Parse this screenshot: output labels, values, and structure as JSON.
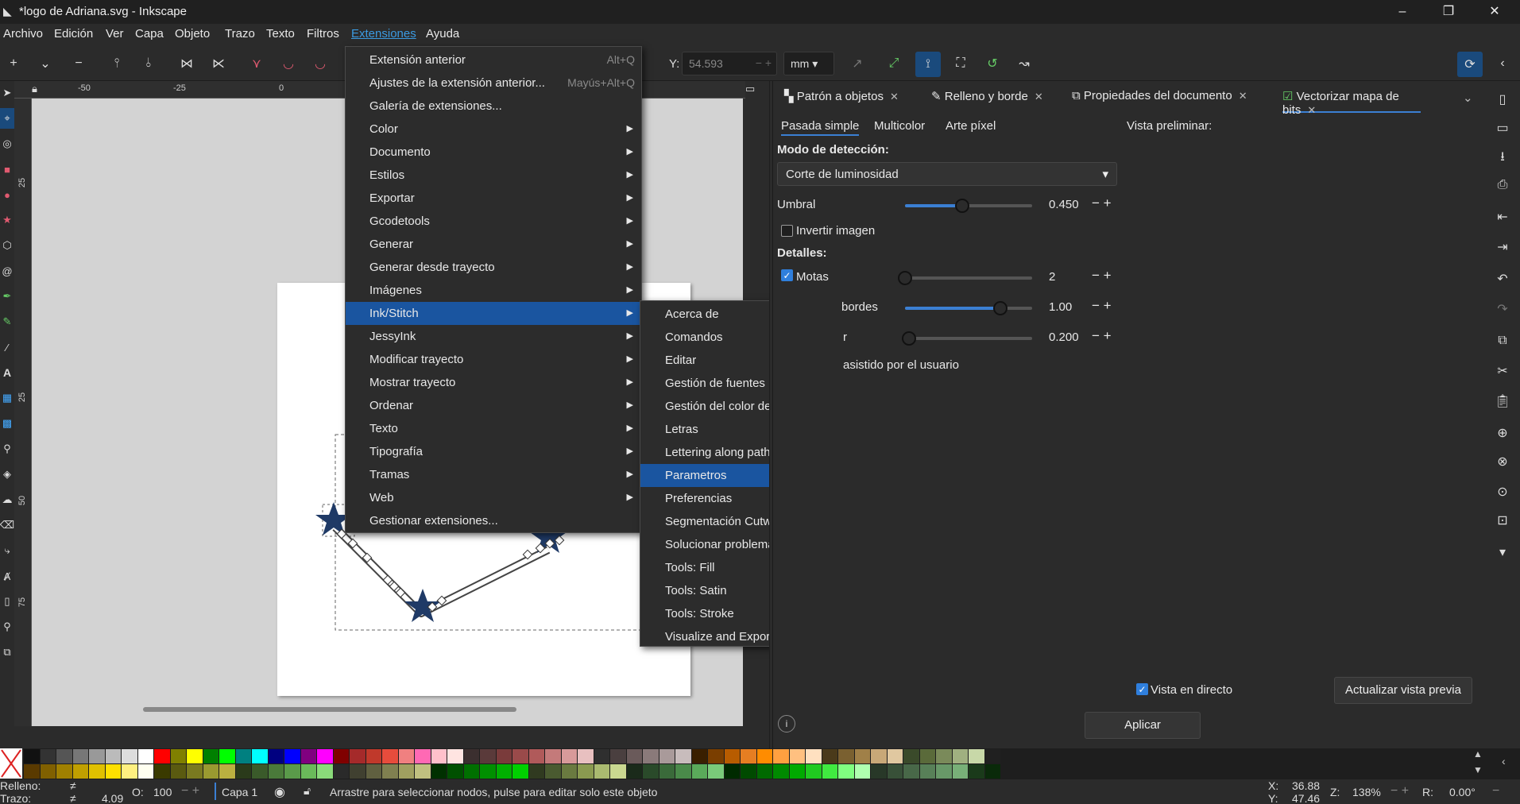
{
  "window": {
    "title": "*logo de  Adriana.svg - Inkscape",
    "controls": [
      "–",
      "❐",
      "✕"
    ]
  },
  "menubar": {
    "items": [
      "Archivo",
      "Edición",
      "Ver",
      "Capa",
      "Objeto",
      "Trazo",
      "Texto",
      "Filtros",
      "Extensiones",
      "Ayuda"
    ],
    "active": "Extensiones"
  },
  "toolbar": {
    "y_label": "Y:",
    "y_value": "54.593",
    "unit": "mm"
  },
  "extensions_menu": {
    "items": [
      {
        "label": "Extensión anterior",
        "shortcut": "Alt+Q"
      },
      {
        "label": "Ajustes de la extensión anterior...",
        "shortcut": "Mayús+Alt+Q"
      },
      {
        "label": "Galería de extensiones..."
      },
      {
        "label": "Color",
        "submenu": true
      },
      {
        "label": "Documento",
        "submenu": true
      },
      {
        "label": "Estilos",
        "submenu": true
      },
      {
        "label": "Exportar",
        "submenu": true
      },
      {
        "label": "Gcodetools",
        "submenu": true
      },
      {
        "label": "Generar",
        "submenu": true
      },
      {
        "label": "Generar desde trayecto",
        "submenu": true
      },
      {
        "label": "Imágenes",
        "submenu": true
      },
      {
        "label": "Ink/Stitch",
        "submenu": true,
        "highlighted": true
      },
      {
        "label": "JessyInk",
        "submenu": true
      },
      {
        "label": "Modificar trayecto",
        "submenu": true
      },
      {
        "label": "Mostrar trayecto",
        "submenu": true
      },
      {
        "label": "Ordenar",
        "submenu": true
      },
      {
        "label": "Texto",
        "submenu": true
      },
      {
        "label": "Tipografía",
        "submenu": true
      },
      {
        "label": "Tramas",
        "submenu": true
      },
      {
        "label": "Web",
        "submenu": true
      },
      {
        "label": "Gestionar extensiones..."
      }
    ]
  },
  "inkstitch_menu": {
    "items": [
      {
        "label": "Acerca de"
      },
      {
        "label": "Comandos",
        "submenu": true
      },
      {
        "label": "Editar",
        "submenu": true
      },
      {
        "label": "Gestión de fuentes",
        "submenu": true
      },
      {
        "label": "Gestión del color del hilo",
        "submenu": true
      },
      {
        "label": "Letras"
      },
      {
        "label": "Lettering along path..."
      },
      {
        "label": "Parametros",
        "highlighted": true
      },
      {
        "label": "Preferencias"
      },
      {
        "label": "Segmentación Cutwork..."
      },
      {
        "label": "Solucionar problemas",
        "submenu": true
      },
      {
        "label": "Tools: Fill",
        "submenu": true
      },
      {
        "label": "Tools: Satin",
        "submenu": true
      },
      {
        "label": "Tools: Stroke",
        "submenu": true
      },
      {
        "label": "Visualize and Export",
        "submenu": true
      }
    ]
  },
  "dock": {
    "tabs": [
      "Patrón a objetos",
      "Relleno y borde",
      "Propiedades del documento",
      "Vectorizar mapa de bits"
    ],
    "active_tab": "Vectorizar mapa de bits",
    "subtabs": [
      "Pasada simple",
      "Multicolor",
      "Arte píxel"
    ],
    "active_subtab": "Pasada simple",
    "preview_label": "Vista preliminar:",
    "detection_mode_label": "Modo de detección:",
    "detection_mode_value": "Corte de luminosidad",
    "threshold_label": "Umbral",
    "threshold_value": "0.450",
    "threshold_level": 0.45,
    "invert_label": "Invertir imagen",
    "invert_checked": false,
    "details_label": "Detalles:",
    "speckles_label": "Motas",
    "speckles_checked": true,
    "speckles_value": "2",
    "speckles_level": 0.0,
    "corners_label_partial": "bordes",
    "corners_value": "1.00",
    "corners_level": 0.75,
    "optimize_label_partial": "r",
    "optimize_value": "0.200",
    "optimize_level": 0.03,
    "user_assisted_partial": "asistido por el usuario",
    "live_preview_label": "Vista en directo",
    "live_preview_checked": true,
    "update_preview_button": "Actualizar vista previa",
    "apply_button": "Aplicar"
  },
  "rulers": {
    "h_labels": [
      "-50",
      "-25",
      "0"
    ],
    "v_labels": [
      "25",
      "25",
      "50",
      "75"
    ]
  },
  "statusbar": {
    "fill_label": "Relleno:",
    "fill_value": "≠",
    "stroke_label": "Trazo:",
    "stroke_value": "≠",
    "stroke_width": "4.09",
    "opacity_label": "O:",
    "opacity_value": "100",
    "layer_label": "Capa 1",
    "message": "Arrastre para seleccionar nodos, pulse para editar solo este objeto",
    "x_label": "X:",
    "x_value": "36.88",
    "y_label": "Y:",
    "y_value": "47.46",
    "zoom_label": "Z:",
    "zoom_value": "138%",
    "rotation_label": "R:",
    "rotation_value": "0.00°"
  },
  "colors": {
    "accent": "#1a55a0",
    "menu_active": "#3b9ae1",
    "star": "#1f3a66"
  },
  "palette": {
    "row1": [
      "#111111",
      "#333333",
      "#555555",
      "#777777",
      "#999999",
      "#bbbbbb",
      "#dddddd",
      "#ffffff",
      "#ff0000",
      "#808000",
      "#ffff00",
      "#008000",
      "#00ff00",
      "#008080",
      "#00ffff",
      "#000080",
      "#0000ff",
      "#800080",
      "#ff00ff",
      "#800000",
      "#a52a2a",
      "#c0392b",
      "#e74c3c",
      "#f08080",
      "#ff69b4",
      "#ffc0cb",
      "#ffe4e1",
      "#3b2f2f",
      "#5a3a3a",
      "#7a3b3b",
      "#9a4a4a",
      "#b05a5a",
      "#c47a7a",
      "#d89a9a",
      "#e8c0c0",
      "#2f2f2f",
      "#4a3f3f",
      "#6a5a5a",
      "#8a7a7a",
      "#a99a9a",
      "#c8bcbc",
      "#3a1f00",
      "#7a3e00",
      "#b85c00",
      "#e67e22",
      "#ff8c00",
      "#ffa040",
      "#ffc080",
      "#ffe0c0",
      "#4a3a1a",
      "#7a6030",
      "#a08048",
      "#c8a878",
      "#e0c8a0",
      "#3a4a2a",
      "#5a6a3a",
      "#7a8a5a",
      "#a0b080",
      "#c8d8a8",
      "#202020"
    ],
    "row2": [
      "#5a3a00",
      "#806000",
      "#a08000",
      "#c0a000",
      "#e0c000",
      "#ffe000",
      "#fff080",
      "#fffff0",
      "#3a3a00",
      "#5a5a10",
      "#7a7a20",
      "#9a9a30",
      "#bab040",
      "#2a3a1a",
      "#3a5a2a",
      "#4a7a3a",
      "#5a9a4a",
      "#6aba5a",
      "#8ada7a",
      "#2a2a2a",
      "#404030",
      "#606040",
      "#808050",
      "#a0a060",
      "#c0c080",
      "#003000",
      "#005000",
      "#007000",
      "#009000",
      "#00b000",
      "#00d000",
      "#303a20",
      "#4a5a30",
      "#6a7a40",
      "#8a9a50",
      "#aaba70",
      "#cad890",
      "#1a2a1a",
      "#2a4a2a",
      "#3a6a3a",
      "#4a8a4a",
      "#5aaa5a",
      "#7aca7a",
      "#002a00",
      "#004a00",
      "#006a00",
      "#008a00",
      "#00aa00",
      "#20ca20",
      "#40ea40",
      "#80ff80",
      "#b0ffb0",
      "#283828",
      "#385038",
      "#486848",
      "#588058",
      "#689868",
      "#78b078",
      "#1a3a1a",
      "#0a2a0a"
    ]
  }
}
